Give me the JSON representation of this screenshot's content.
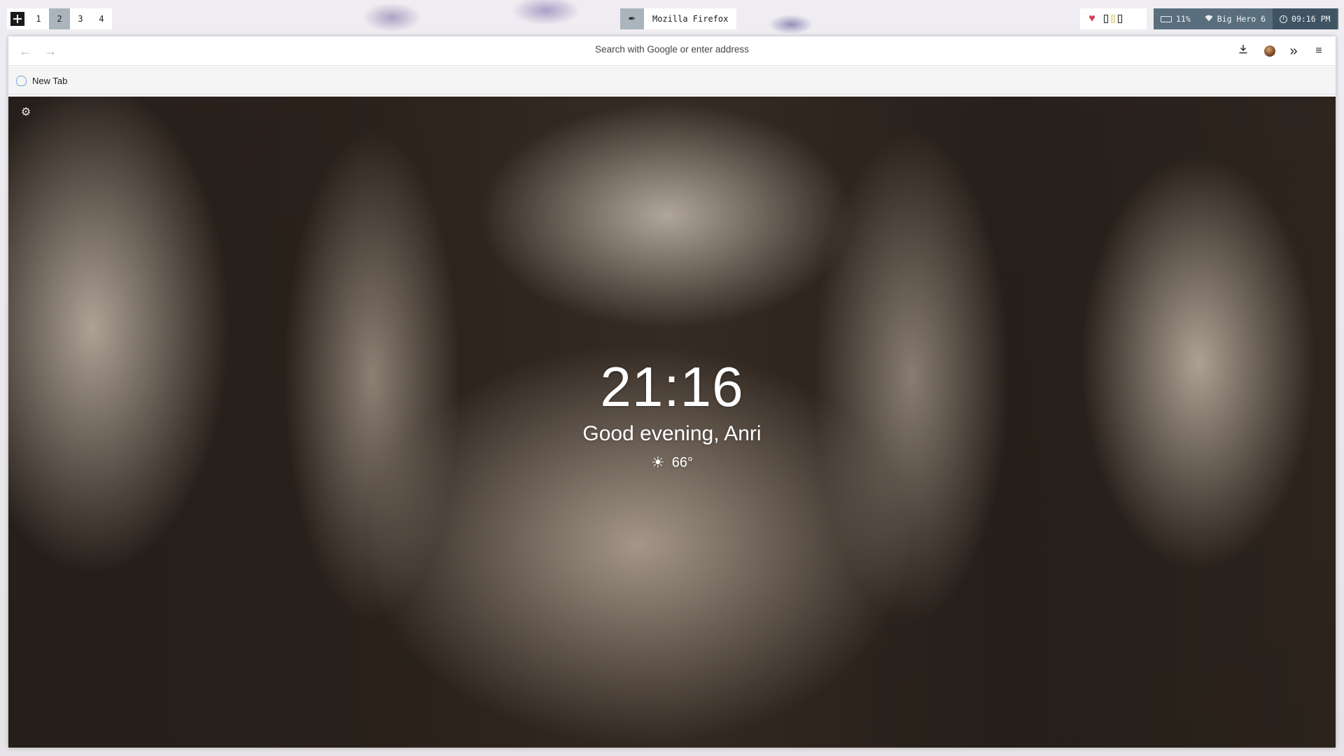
{
  "topbar": {
    "workspaces": [
      "1",
      "2",
      "3",
      "4"
    ],
    "active_workspace": "2",
    "window_title": "Mozilla Firefox",
    "status": {
      "battery": "11%",
      "wifi": "Big Hero 6",
      "time": "09:16 PM"
    }
  },
  "browser": {
    "url_placeholder": "Search with Google or enter address",
    "tab_label": "New Tab"
  },
  "newtab": {
    "clock": "21:16",
    "greeting": "Good evening, Anri",
    "temperature": "66°"
  },
  "colors": {
    "accent": "#a9b4bd",
    "status_bg": "#5a6f7d",
    "status_dark": "#3f5463",
    "heart": "#d2404f"
  }
}
